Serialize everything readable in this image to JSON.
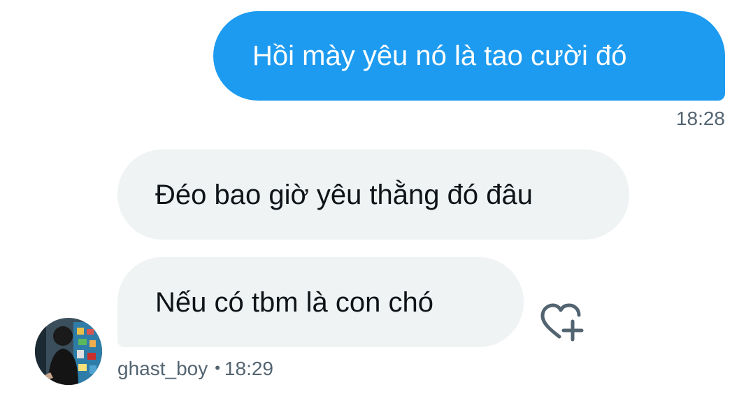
{
  "messages": [
    {
      "text": "Hồi mày yêu nó là tao cười đó",
      "time": "18:28"
    },
    {
      "text": "Đéo bao giờ yêu thằng đó đâu"
    },
    {
      "text": "Nếu có tbm là con chó"
    }
  ],
  "sender": {
    "username": "ghast_boy",
    "separator": "•",
    "time": "18:29"
  },
  "icons": {
    "react": "heart-plus-icon",
    "avatar": "profile-photo"
  },
  "colors": {
    "sent_bubble": "#1d9bf0",
    "received_bubble": "#eff3f4",
    "muted_text": "#536471"
  }
}
